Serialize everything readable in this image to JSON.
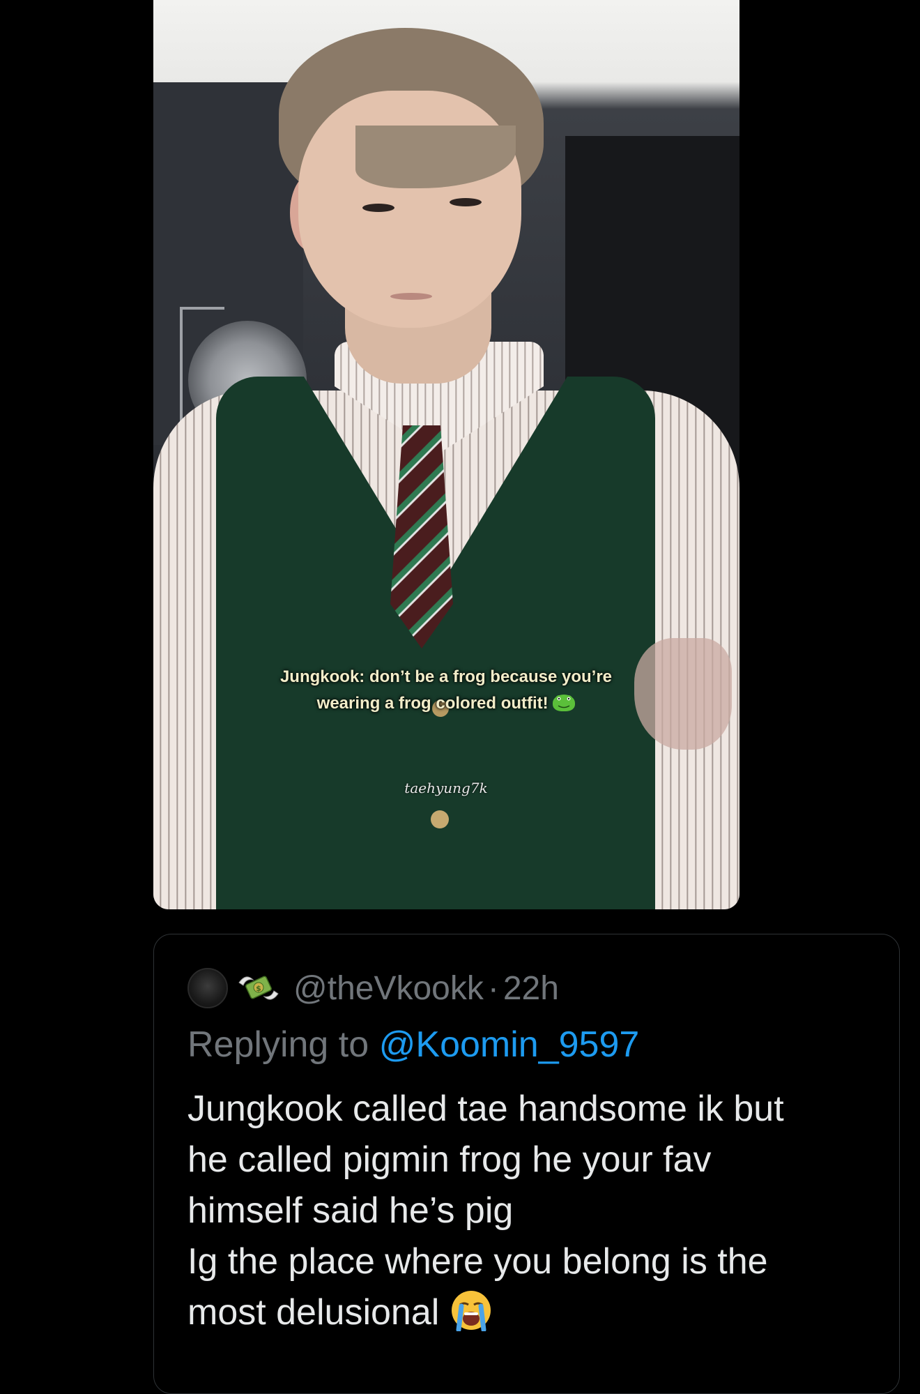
{
  "media": {
    "caption_line1": "Jungkook: don’t be a frog because you’re",
    "caption_line2": "wearing a frog colored outfit!",
    "caption_emoji": "frog-emoji",
    "watermark": "taehyung7k"
  },
  "reply": {
    "avatar_icon": "avatar",
    "badge_icon": "money-with-wings-icon",
    "handle": "@theVkookk",
    "separator": "·",
    "time": "22h",
    "replying_prefix": "Replying to ",
    "replying_to": "@Koomin_9597",
    "body_lines": [
      "Jungkook called tae handsome ik but",
      "he called pigmin frog he your fav",
      "himself said he’s pig",
      "Ig the place where you belong is the",
      "most delusional"
    ],
    "end_emoji": "loudly-crying-face-emoji"
  },
  "colors": {
    "background": "#000000",
    "text": "#e7e9ea",
    "muted": "#71767b",
    "link": "#1d9bf0",
    "border": "#2f3336"
  }
}
